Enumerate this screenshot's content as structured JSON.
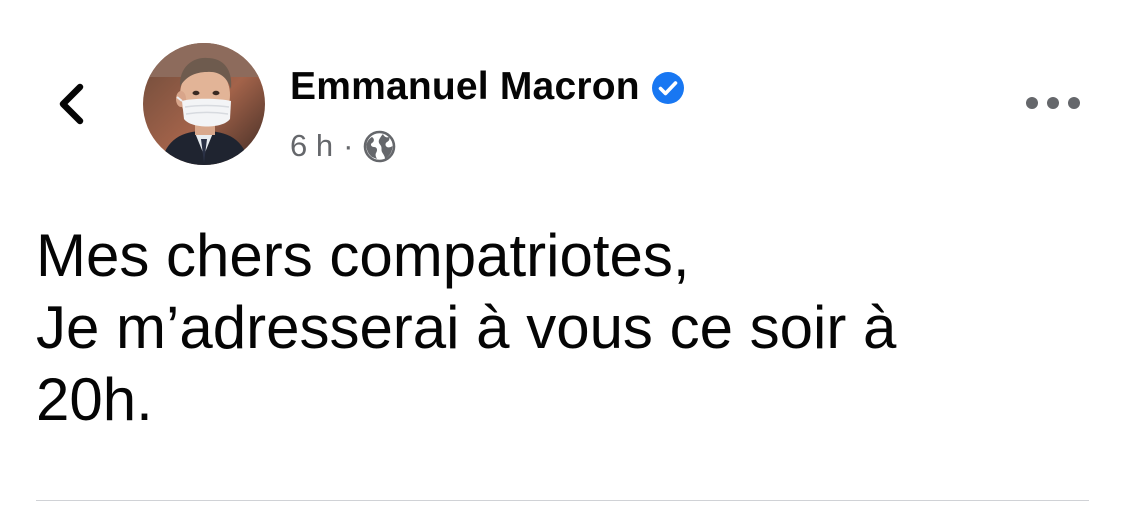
{
  "header": {
    "back_icon": "chevron-left-icon",
    "author_name": "Emmanuel Macron",
    "verified_icon": "verified-badge-icon",
    "timestamp": "6 h",
    "separator": "·",
    "audience_icon": "globe-icon",
    "more_icon": "more-horizontal-icon"
  },
  "post": {
    "text_lines": [
      "Mes chers compatriotes,",
      "Je m’adresserai à vous ce soir à",
      "20h."
    ]
  },
  "colors": {
    "verified_blue": "#1877f2",
    "secondary_text": "#65676b",
    "primary_text": "#050505",
    "divider": "#d0d2d6"
  }
}
